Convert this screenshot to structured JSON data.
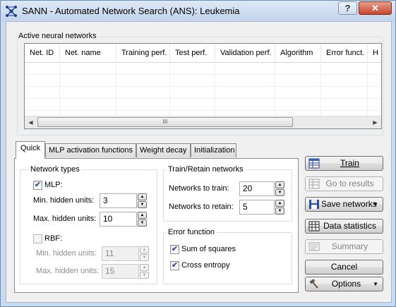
{
  "window": {
    "title": "SANN - Automated Network Search (ANS): Leukemia",
    "help_glyph": "?",
    "close_glyph": "✕"
  },
  "networks": {
    "group_label": "Active neural networks",
    "columns": [
      "Net. ID",
      "Net. name",
      "Training perf.",
      "Test perf.",
      "Validation perf.",
      "Algorithm",
      "Error funct.",
      "H"
    ],
    "rows": [],
    "scrollbar_thumb_glyph": "III"
  },
  "tabs": [
    {
      "label": "Quick",
      "active": true
    },
    {
      "label": "MLP activation functions",
      "active": false
    },
    {
      "label": "Weight decay",
      "active": false
    },
    {
      "label": "Initialization",
      "active": false
    }
  ],
  "network_types": {
    "group_label": "Network types",
    "mlp": {
      "label": "MLP:",
      "checked": true
    },
    "mlp_min_hidden": {
      "label": "Min. hidden units:",
      "value": "3"
    },
    "mlp_max_hidden": {
      "label": "Max. hidden units:",
      "value": "10"
    },
    "rbf": {
      "label": "RBF:",
      "checked": false
    },
    "rbf_min_hidden": {
      "label": "Min. hidden units:",
      "value": "11"
    },
    "rbf_max_hidden": {
      "label": "Max. hidden units:",
      "value": "15"
    }
  },
  "train_retain": {
    "group_label": "Train/Retain networks",
    "train": {
      "label": "Networks to train:",
      "value": "20"
    },
    "retain": {
      "label": "Networks to retain:",
      "value": "5"
    }
  },
  "error_function": {
    "group_label": "Error function",
    "sum_of_squares": {
      "label": "Sum of squares",
      "checked": true
    },
    "cross_entropy": {
      "label": "Cross entropy",
      "checked": true
    }
  },
  "buttons": {
    "train": "Train",
    "go_to_results": "Go to results",
    "save_networks": "Save networks",
    "data_statistics": "Data statistics",
    "summary": "Summary",
    "cancel": "Cancel",
    "options": "Options"
  },
  "checkmark_glyph": "✔",
  "spin_up_glyph": "▲",
  "spin_down_glyph": "▼",
  "dropdown_glyph": "▼",
  "scroll_left_glyph": "◀",
  "scroll_right_glyph": "▶",
  "colors": {
    "title_gradient_top": "#dfe9f6",
    "close_red": "#c8452c",
    "check_blue": "#1a3a8a"
  }
}
